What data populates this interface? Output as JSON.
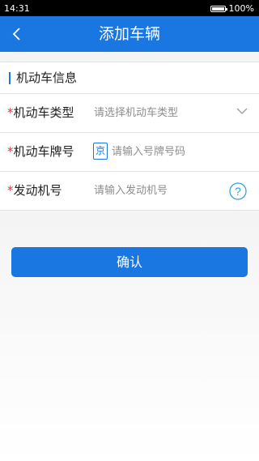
{
  "status_bar": {
    "time": "14:31",
    "battery_level": 1.0,
    "battery_text": "100%"
  },
  "header": {
    "title": "添加车辆",
    "back_icon": "chevron-left-icon",
    "background": "#1a76e0"
  },
  "section": {
    "title": "机动车信息"
  },
  "form": {
    "vehicle_type": {
      "required_mark": "*",
      "label": "机动车类型",
      "placeholder": "请选择机动车类型",
      "icon": "chevron-down-icon"
    },
    "plate_number": {
      "required_mark": "*",
      "label": "机动车牌号",
      "prefix": "京",
      "placeholder": "请输入号牌号码"
    },
    "engine_number": {
      "required_mark": "*",
      "label": "发动机号",
      "placeholder": "请输入发动机号",
      "help_icon": "question-circle-icon",
      "help_text": "?"
    }
  },
  "confirm_button": {
    "label": "确认"
  },
  "colors": {
    "accent": "#1a76e0",
    "required": "#e23333"
  }
}
